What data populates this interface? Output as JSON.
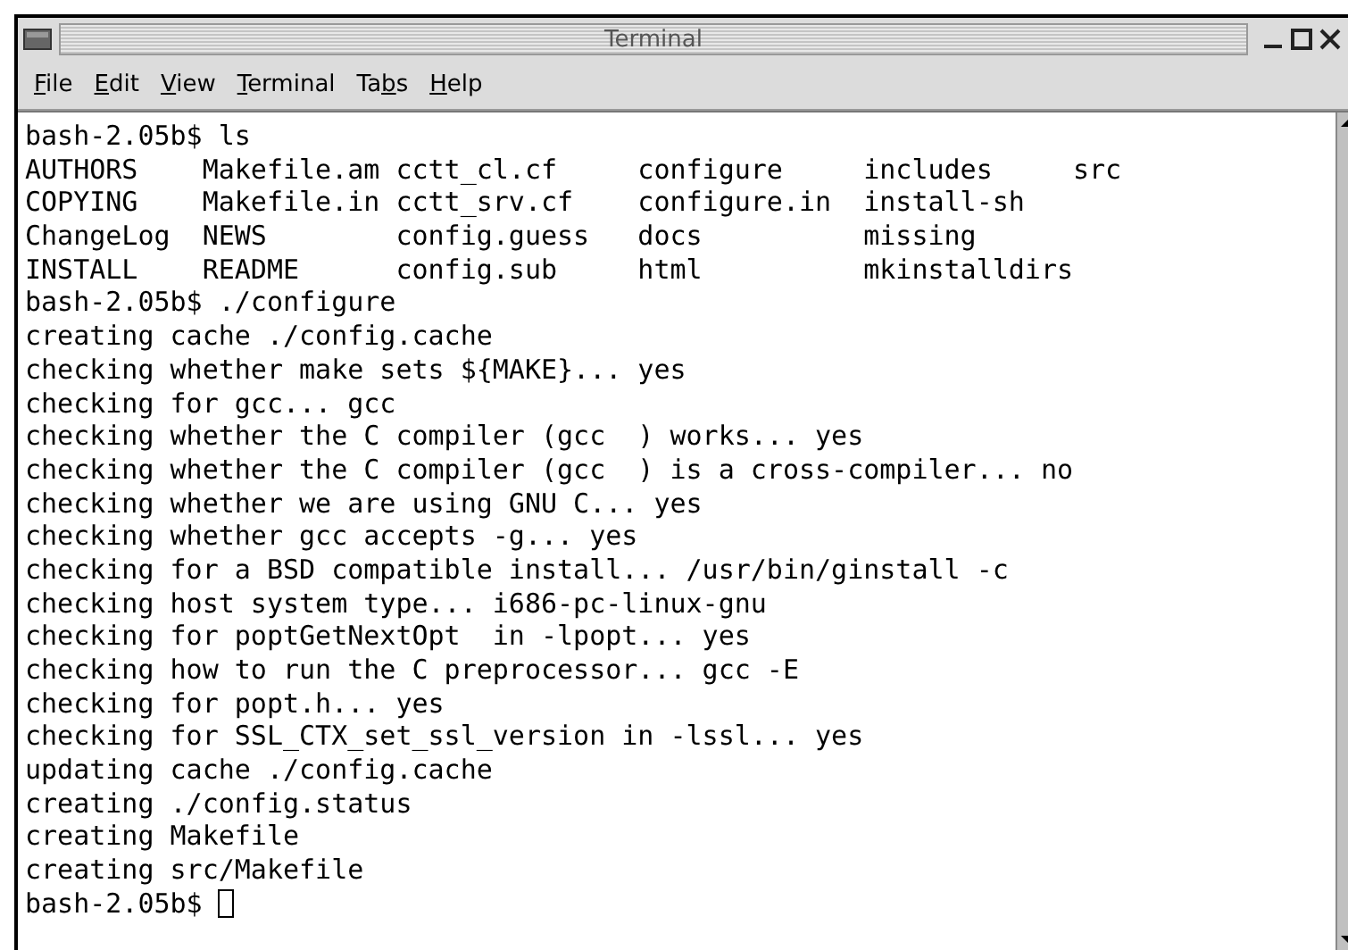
{
  "window": {
    "title": "Terminal"
  },
  "menu": [
    {
      "key": "F",
      "after": "ile"
    },
    {
      "key": "E",
      "after": "dit"
    },
    {
      "key": "V",
      "after": "iew"
    },
    {
      "key": "T",
      "after": "erminal"
    },
    {
      "before": "Ta",
      "key": "b",
      "after": "s"
    },
    {
      "key": "H",
      "after": "elp"
    }
  ],
  "terminal": {
    "lines": [
      "bash-2.05b$ ls",
      "AUTHORS    Makefile.am cctt_cl.cf     configure     includes     src",
      "COPYING    Makefile.in cctt_srv.cf    configure.in  install-sh",
      "ChangeLog  NEWS        config.guess   docs          missing",
      "INSTALL    README      config.sub     html          mkinstalldirs",
      "bash-2.05b$ ./configure",
      "creating cache ./config.cache",
      "checking whether make sets ${MAKE}... yes",
      "checking for gcc... gcc",
      "checking whether the C compiler (gcc  ) works... yes",
      "checking whether the C compiler (gcc  ) is a cross-compiler... no",
      "checking whether we are using GNU C... yes",
      "checking whether gcc accepts -g... yes",
      "checking for a BSD compatible install... /usr/bin/ginstall -c",
      "checking host system type... i686-pc-linux-gnu",
      "checking for poptGetNextOpt  in -lpopt... yes",
      "checking how to run the C preprocessor... gcc -E",
      "checking for popt.h... yes",
      "checking for SSL_CTX_set_ssl_version in -lssl... yes",
      "updating cache ./config.cache",
      "creating ./config.status",
      "creating Makefile",
      "creating src/Makefile",
      "bash-2.05b$"
    ],
    "cursor_shown": true
  }
}
